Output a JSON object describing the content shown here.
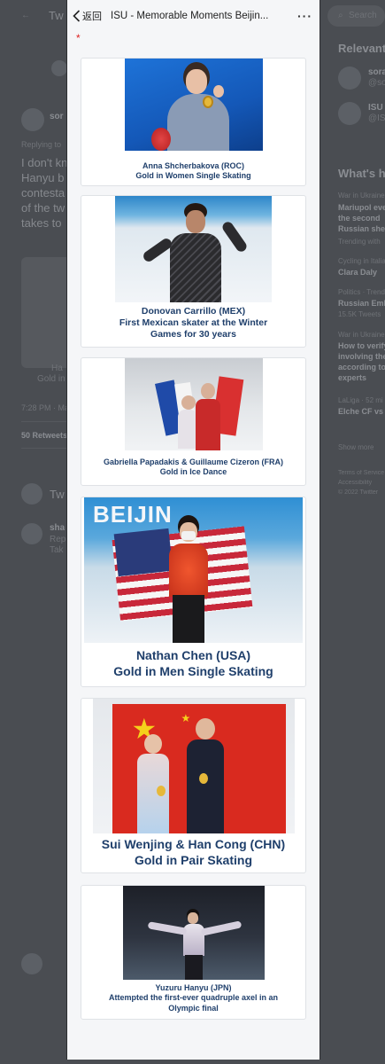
{
  "nav": {
    "back_label": "返回",
    "title": "ISU - Memorable Moments Beijin...",
    "more_label": "···"
  },
  "required_mark": "*",
  "cards": [
    {
      "line1": "Anna Shcherbakova (ROC)",
      "line2": "Gold in Women Single Skating"
    },
    {
      "line1": "Donovan Carrillo (MEX)",
      "line2": "First Mexican skater at the Winter",
      "line3": "Games for 30 years"
    },
    {
      "line1": "Gabriella Papadakis & Guillaume Cizeron (FRA)",
      "line2": "Gold in Ice Dance"
    },
    {
      "line1": "Nathan Chen (USA)",
      "line2": "Gold in Men Single Skating"
    },
    {
      "line1": "Sui Wenjing & Han Cong (CHN)",
      "line2": "Gold in Pair Skating"
    },
    {
      "line1": "Yuzuru Hanyu (JPN)",
      "line2": "Attempted the first-ever quadruple axel in an",
      "line3": "Olympic final"
    }
  ],
  "photo_texts": {
    "beijing_banner": "BEIJIN"
  },
  "background": {
    "left": {
      "header": "Tw",
      "author": "sor",
      "replying": "Replying to",
      "tweet_lines": [
        "I don't kn",
        "Hanyu b",
        "contesta",
        "of the tw",
        "takes to"
      ],
      "media_caption": [
        "Ha",
        "Gold in"
      ],
      "time": "7:28 PM · Ma",
      "retweets": "50 Retweets",
      "reply_header": "Tw",
      "reply_author": "sha",
      "reply_lines": [
        "Rep",
        "Tak"
      ]
    },
    "right": {
      "search": "Search",
      "relevant": "Relevant",
      "accounts": [
        [
          "sora",
          "@sor"
        ],
        [
          "ISU",
          "@ISU"
        ]
      ],
      "whats_happening": "What's ha",
      "trends": [
        [
          "War in Ukraine",
          "Mariupol eve",
          "the second",
          "Russian shel"
        ],
        [
          "Trending with"
        ],
        [
          "Cycling in Italia",
          "Clara Daly"
        ],
        [
          "Politics · Trending",
          "Russian Emb",
          "15.5K Tweets"
        ],
        [
          "War in Ukraine",
          "How to verify",
          "involving the",
          "according to",
          "experts"
        ],
        [
          "LaLiga · 52 mi",
          "Elche CF vs I"
        ]
      ],
      "show_more": "Show more",
      "footer": [
        "Terms of Service",
        "Accessibility",
        "© 2022 Twitter"
      ]
    }
  },
  "colors": {
    "caption": "#1f3f6b",
    "required": "#dd2222",
    "overlay": "#4a4d52"
  }
}
